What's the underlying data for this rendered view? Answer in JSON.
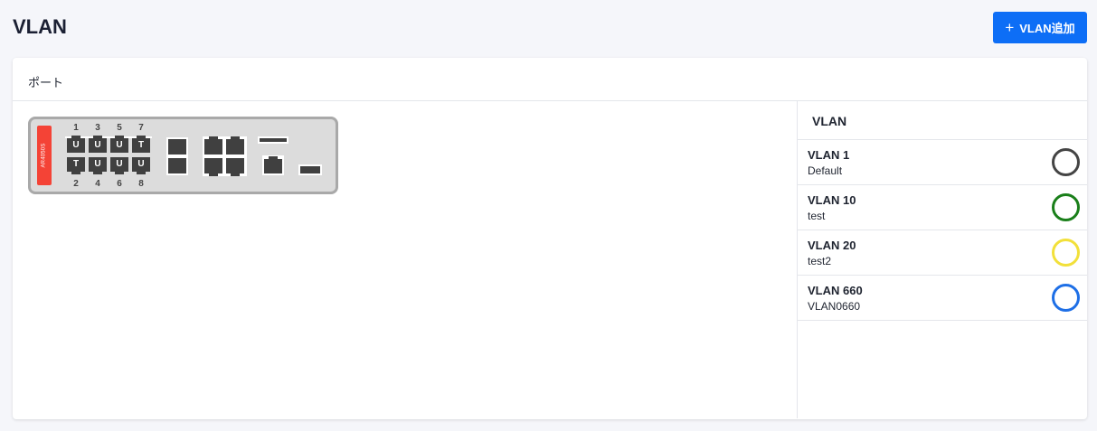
{
  "page": {
    "title": "VLAN"
  },
  "toolbar": {
    "add_label": "VLAN追加",
    "add_icon": "plus-icon",
    "accent": "#0d6ef6"
  },
  "ports_card": {
    "title": "ポート"
  },
  "device": {
    "model": "AR4050S",
    "brand_color": "#f44336",
    "top_numbers": [
      "1",
      "3",
      "5",
      "7"
    ],
    "bottom_numbers": [
      "2",
      "4",
      "6",
      "8"
    ],
    "top_ports": [
      "U",
      "U",
      "U",
      "T"
    ],
    "bottom_ports": [
      "T",
      "U",
      "U",
      "U"
    ]
  },
  "vlan_panel": {
    "title": "VLAN",
    "items": [
      {
        "name": "VLAN 1",
        "desc": "Default",
        "color": "#444444"
      },
      {
        "name": "VLAN 10",
        "desc": "test",
        "color": "#1a7f1a"
      },
      {
        "name": "VLAN 20",
        "desc": "test2",
        "color": "#f2e03a"
      },
      {
        "name": "VLAN 660",
        "desc": "VLAN0660",
        "color": "#1e6fe6"
      }
    ]
  }
}
